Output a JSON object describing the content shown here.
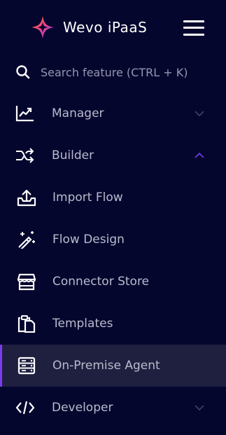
{
  "app": {
    "title": "Wevo iPaaS"
  },
  "search": {
    "placeholder": "Search feature (CTRL + K)",
    "value": ""
  },
  "nav": {
    "manager": {
      "label": "Manager",
      "icon": "chart-line-icon",
      "expanded": false
    },
    "builder": {
      "label": "Builder",
      "icon": "shuffle-icon",
      "expanded": true,
      "items": [
        {
          "label": "Import Flow",
          "icon": "upload-tray-icon"
        },
        {
          "label": "Flow Design",
          "icon": "magic-wand-icon"
        },
        {
          "label": "Connector Store",
          "icon": "store-icon"
        },
        {
          "label": "Templates",
          "icon": "clipboard-copy-icon"
        },
        {
          "label": "On-Premise Agent",
          "icon": "server-icon",
          "active": true
        }
      ]
    },
    "developer": {
      "label": "Developer",
      "icon": "code-icon",
      "expanded": false
    }
  },
  "colors": {
    "background": "#05062e",
    "active_bg": "#1f2040",
    "active_accent": "#7c3aed",
    "text": "#b9bbcb",
    "white": "#ffffff"
  }
}
